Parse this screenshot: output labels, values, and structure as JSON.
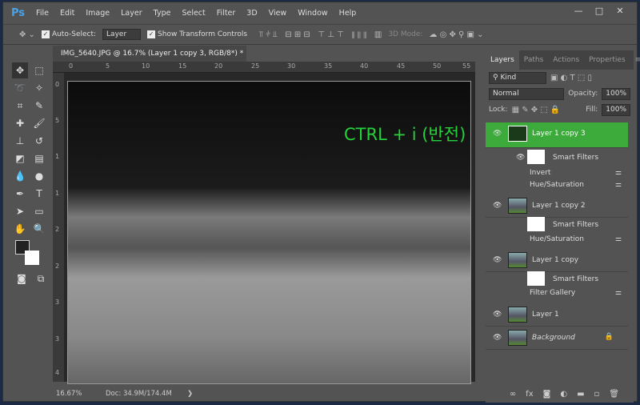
{
  "app": {
    "logo": "Ps",
    "menu": [
      "File",
      "Edit",
      "Image",
      "Layer",
      "Type",
      "Select",
      "Filter",
      "3D",
      "View",
      "Window",
      "Help"
    ],
    "window_buttons": [
      "—",
      "□",
      "✕"
    ]
  },
  "options": {
    "auto_select_label": "Auto-Select:",
    "auto_select_value": "Layer",
    "show_transform_label": "Show Transform Controls",
    "mode_3d": "3D Mode:"
  },
  "document": {
    "tab_title": "IMG_5640.JPG @ 16.7% (Layer 1 copy 3, RGB/8*) *",
    "close": "×",
    "ruler_top": [
      "0",
      "5",
      "10",
      "15",
      "20",
      "25",
      "30",
      "35",
      "40",
      "45",
      "50",
      "55"
    ],
    "ruler_left": [
      "0",
      "5",
      "1",
      "1",
      "2",
      "2",
      "3",
      "3",
      "4"
    ],
    "annotation": "CTRL + i (반전)"
  },
  "status": {
    "zoom": "16.67%",
    "doc": "Doc: 34.9M/174.4M",
    "arrow": "❯"
  },
  "panel": {
    "tabs": [
      "Layers",
      "Paths",
      "Actions",
      "Properties"
    ],
    "kind": "Kind",
    "blend": "Normal",
    "opacity_label": "Opacity:",
    "opacity": "100%",
    "lock_label": "Lock:",
    "fill_label": "Fill:",
    "fill": "100%",
    "layers": [
      {
        "name": "Layer 1 copy 3",
        "selected": true,
        "smart_filters": "Smart Filters",
        "filters": [
          "Invert",
          "Hue/Saturation"
        ]
      },
      {
        "name": "Layer 1 copy 2",
        "smart_filters": "Smart Filters",
        "filters": [
          "Hue/Saturation"
        ]
      },
      {
        "name": "Layer 1 copy",
        "smart_filters": "Smart Filters",
        "filters": [
          "Filter Gallery"
        ]
      },
      {
        "name": "Layer 1"
      },
      {
        "name": "Background",
        "locked": true
      }
    ]
  }
}
